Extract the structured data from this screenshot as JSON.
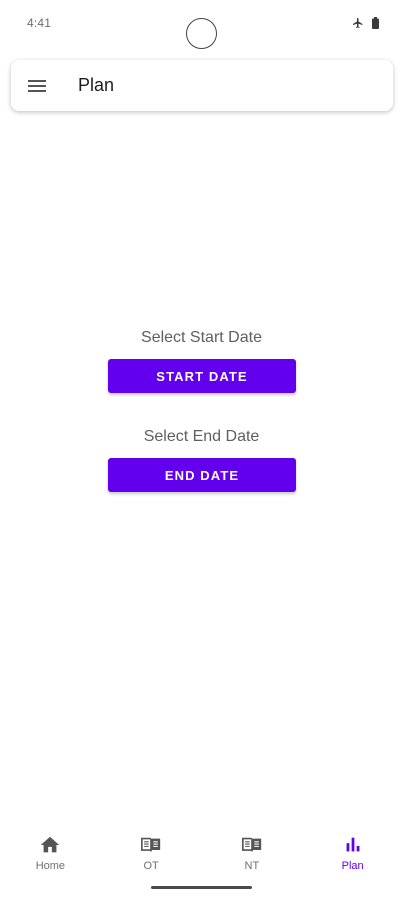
{
  "status_bar": {
    "time": "4:41",
    "icons": [
      "airplane-icon",
      "battery-icon"
    ]
  },
  "app_bar": {
    "menu_icon": "menu-icon",
    "title": "Plan"
  },
  "start": {
    "label": "Select Start Date",
    "button": "START DATE"
  },
  "end": {
    "label": "Select End Date",
    "button": "END DATE"
  },
  "bottom_nav": {
    "items": [
      {
        "label": "Home",
        "icon": "home-icon",
        "active": false
      },
      {
        "label": "OT",
        "icon": "book-icon",
        "active": false
      },
      {
        "label": "NT",
        "icon": "book-icon",
        "active": false
      },
      {
        "label": "Plan",
        "icon": "bar-chart-icon",
        "active": true
      }
    ]
  },
  "colors": {
    "accent": "#6200ee",
    "label_gray": "#5f5f5f",
    "nav_inactive": "#707070"
  }
}
